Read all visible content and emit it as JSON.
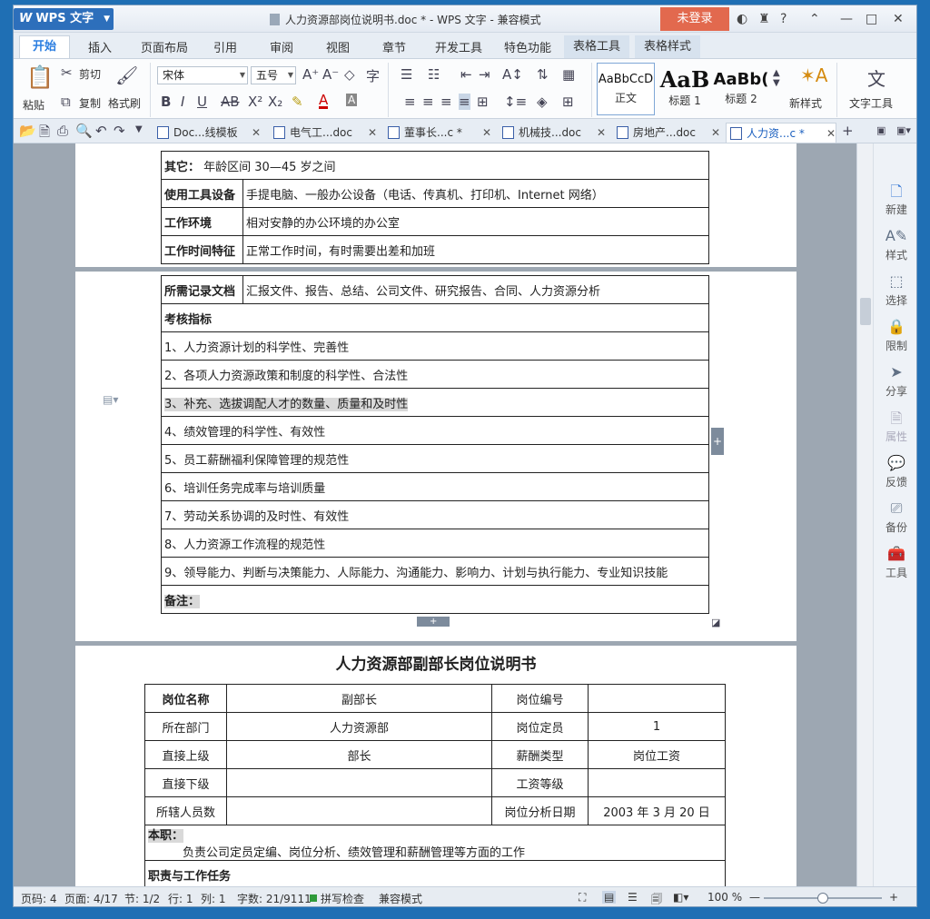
{
  "app": {
    "name": "WPS 文字",
    "window_title": "人力资源部岗位说明书.doc * - WPS 文字 - 兼容模式",
    "login": "未登录"
  },
  "menu": {
    "items": [
      "开始",
      "插入",
      "页面布局",
      "引用",
      "审阅",
      "视图",
      "章节",
      "开发工具",
      "特色功能",
      "表格工具",
      "表格样式"
    ]
  },
  "ribbon": {
    "paste": "粘贴",
    "cut": "剪切",
    "copy": "复制",
    "format_painter": "格式刷",
    "font": "宋体",
    "size": "五号",
    "styles": [
      {
        "preview": "AaBbCcD",
        "label": "正文"
      },
      {
        "preview": "AaB",
        "label": "标题 1"
      },
      {
        "preview": "AaBb(",
        "label": "标题 2"
      }
    ],
    "new_style": "新样式",
    "text_tool": "文字工具"
  },
  "doc_tabs": [
    {
      "label": "Doc...线模板",
      "active": false
    },
    {
      "label": "电气工...doc",
      "active": false
    },
    {
      "label": "董事长...c *",
      "active": false
    },
    {
      "label": "机械技...doc",
      "active": false
    },
    {
      "label": "房地产...doc",
      "active": false
    },
    {
      "label": "人力资...c *",
      "active": true
    }
  ],
  "page1": {
    "rows": [
      {
        "label": "其它：",
        "value": "年龄区间 30—45 岁之间"
      },
      {
        "label": "使用工具设备",
        "value": "手提电脑、一般办公设备（电话、传真机、打印机、Internet 网络）"
      },
      {
        "label": "工作环境",
        "value": "相对安静的办公环境的办公室"
      },
      {
        "label": "工作时间特征",
        "value": "正常工作时间，有时需要出差和加班"
      }
    ]
  },
  "page2": {
    "docs_label": "所需记录文档",
    "docs_value": "汇报文件、报告、总结、公司文件、研究报告、合同、人力资源分析",
    "kpi_title": "考核指标",
    "kpis": [
      "1、人力资源计划的科学性、完善性",
      "2、各项人力资源政策和制度的科学性、合法性",
      "3、补充、选拔调配人才的数量、质量和及时性",
      "4、绩效管理的科学性、有效性",
      "5、员工薪酬福利保障管理的规范性",
      "6、培训任务完成率与培训质量",
      "7、劳动关系协调的及时性、有效性",
      "8、人力资源工作流程的规范性",
      "9、领导能力、判断与决策能力、人际能力、沟通能力、影响力、计划与执行能力、专业知识技能"
    ],
    "remarks": "备注："
  },
  "page3": {
    "title": "人力资源部副部长岗位说明书",
    "rows": [
      [
        "岗位名称",
        "副部长",
        "岗位编号",
        ""
      ],
      [
        "所在部门",
        "人力资源部",
        "岗位定员",
        "1"
      ],
      [
        "直接上级",
        "部长",
        "薪酬类型",
        "岗位工资"
      ],
      [
        "直接下级",
        "",
        "工资等级",
        ""
      ],
      [
        "所辖人员数",
        "",
        "岗位分析日期",
        "2003 年 3 月 20 日"
      ]
    ],
    "duty_label": "本职：",
    "duty_text": "负责公司定员定编、岗位分析、绩效管理和薪酬管理等方面的工作",
    "tasks_label": "职责与工作任务"
  },
  "sidebar": [
    "新建",
    "样式",
    "选择",
    "限制",
    "分享",
    "属性",
    "反馈",
    "备份",
    "工具"
  ],
  "status": {
    "page_no": "页码: 4",
    "pages": "页面: 4/17",
    "section": "节: 1/2",
    "row": "行: 1",
    "col": "列: 1",
    "words": "字数: 21/9111",
    "spell": "拼写检查",
    "mode": "兼容模式",
    "zoom": "100 %",
    "zoom_level": 0.5
  }
}
